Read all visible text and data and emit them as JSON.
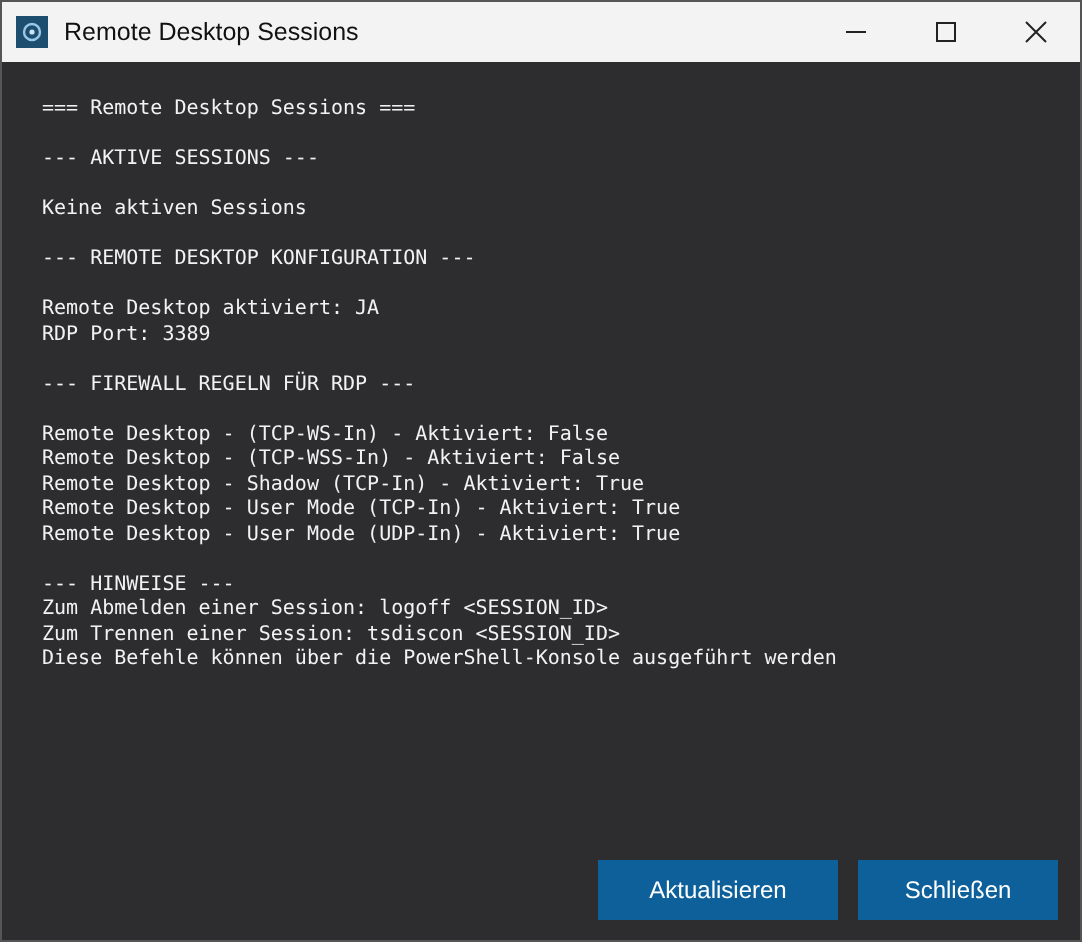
{
  "window": {
    "title": "Remote Desktop Sessions"
  },
  "output": {
    "blocks": [
      [
        "=== Remote Desktop Sessions ==="
      ],
      [
        "--- AKTIVE SESSIONS ---"
      ],
      [
        "Keine aktiven Sessions"
      ],
      [
        "--- REMOTE DESKTOP KONFIGURATION ---"
      ],
      [
        "Remote Desktop aktiviert: JA",
        "RDP Port: 3389"
      ],
      [
        "--- FIREWALL REGELN FÜR RDP ---"
      ],
      [
        "Remote Desktop - (TCP-WS-In) - Aktiviert: False",
        "Remote Desktop - (TCP-WSS-In) - Aktiviert: False",
        "Remote Desktop - Shadow (TCP-In) - Aktiviert: True",
        "Remote Desktop - User Mode (TCP-In) - Aktiviert: True",
        "Remote Desktop - User Mode (UDP-In) - Aktiviert: True"
      ],
      [
        "--- HINWEISE ---",
        "Zum Abmelden einer Session: logoff <SESSION_ID>",
        "Zum Trennen einer Session: tsdiscon <SESSION_ID>",
        "Diese Befehle können über die PowerShell-Konsole ausgeführt werden"
      ]
    ]
  },
  "buttons": [
    "Aktualisieren",
    "Schließen"
  ]
}
